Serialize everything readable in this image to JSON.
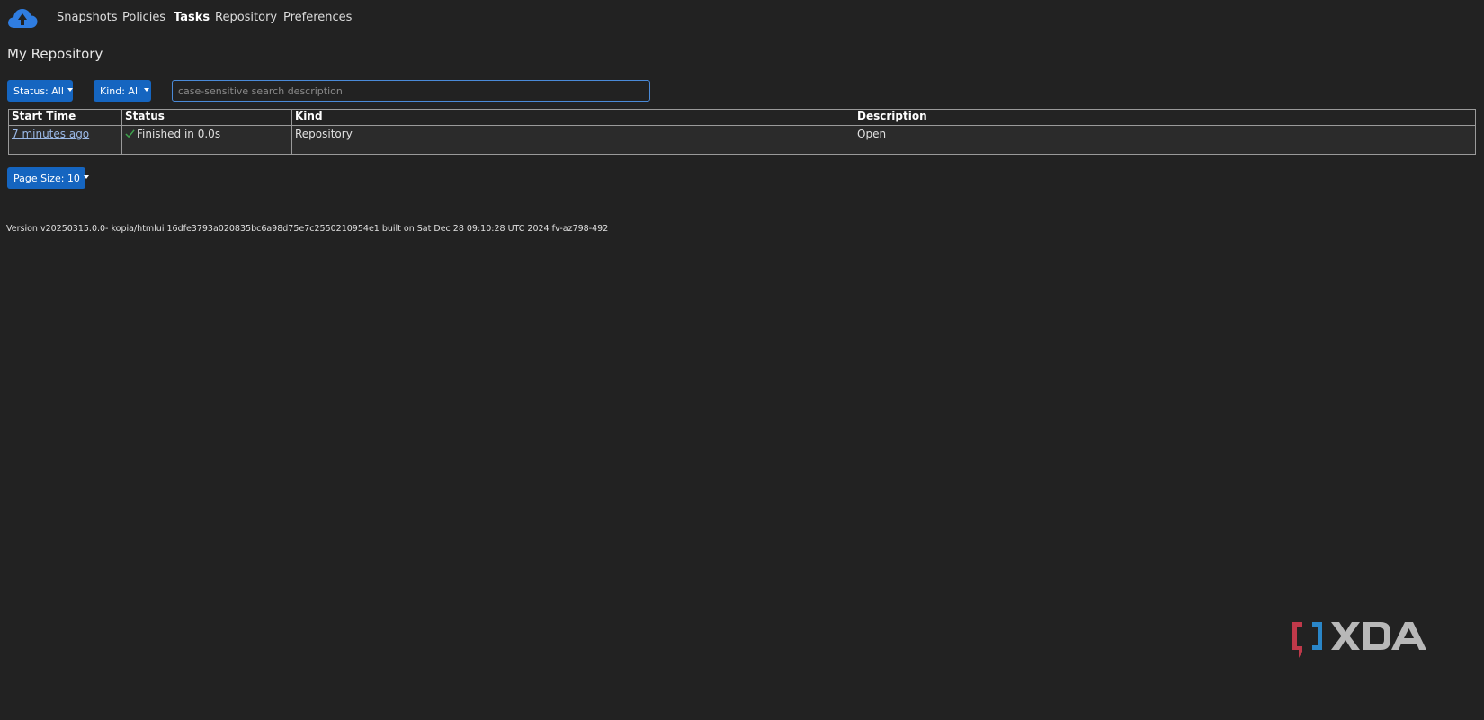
{
  "nav": {
    "items": [
      {
        "label": "Snapshots",
        "active": false
      },
      {
        "label": "Policies",
        "active": false
      },
      {
        "label": "Tasks",
        "active": true
      },
      {
        "label": "Repository",
        "active": false
      },
      {
        "label": "Preferences",
        "active": false
      }
    ]
  },
  "page": {
    "title": "My Repository"
  },
  "filters": {
    "status_label": "Status: All",
    "kind_label": "Kind: All",
    "search_placeholder": "case-sensitive search description",
    "search_value": ""
  },
  "table": {
    "columns": [
      "Start Time",
      "Status",
      "Kind",
      "Description"
    ],
    "rows": [
      {
        "start_time": "7 minutes ago",
        "status": "Finished in 0.0s",
        "kind": "Repository",
        "description": "Open"
      }
    ]
  },
  "pagination": {
    "page_size_label": "Page Size: 10"
  },
  "footer": {
    "version": "Version v20250315.0.0- kopia/htmlui 16dfe3793a020835bc6a98d75e7c2550210954e1 built on Sat Dec 28 09:10:28 UTC 2024 fv-az798-492"
  },
  "colors": {
    "background": "#222222",
    "accent": "#1565c0",
    "success": "#3fa34d",
    "logo_blue": "#2f7de1"
  },
  "icons": {
    "app_logo": "cloud-upload-icon",
    "status_ok": "check-icon",
    "watermark": "xda-logo"
  }
}
